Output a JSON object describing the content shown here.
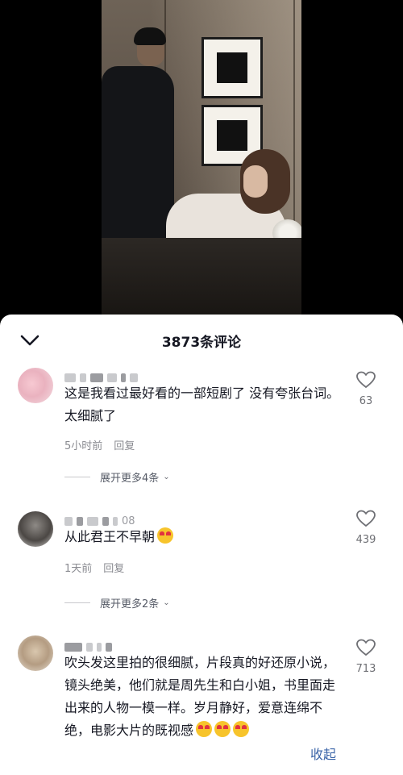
{
  "sheet": {
    "title": "3873条评论",
    "collapse_icon": "chevron-down-icon"
  },
  "comments": [
    {
      "username_suffix": "",
      "text": "这是我看过最好看的一部短剧了 没有夸张台词。太细腻了",
      "time": "5小时前",
      "reply_label": "回复",
      "likes": "63",
      "expand_label": "展开更多4条"
    },
    {
      "username_suffix": "08",
      "text": "从此君王不早朝",
      "time": "1天前",
      "reply_label": "回复",
      "likes": "439",
      "expand_label": "展开更多2条"
    },
    {
      "username_suffix": "",
      "text": "吹头发这里拍的很细腻，片段真的好还原小说，镜头绝美，他们就是周先生和白小姐，书里面走出来的人物一模一样。岁月静好，爱意连绵不绝，电影大片的既视感",
      "likes": "713",
      "collapse_label": "收起"
    }
  ],
  "colors": {
    "link": "#3a64a8",
    "text": "#161823",
    "secondary": "#8a8b91"
  }
}
